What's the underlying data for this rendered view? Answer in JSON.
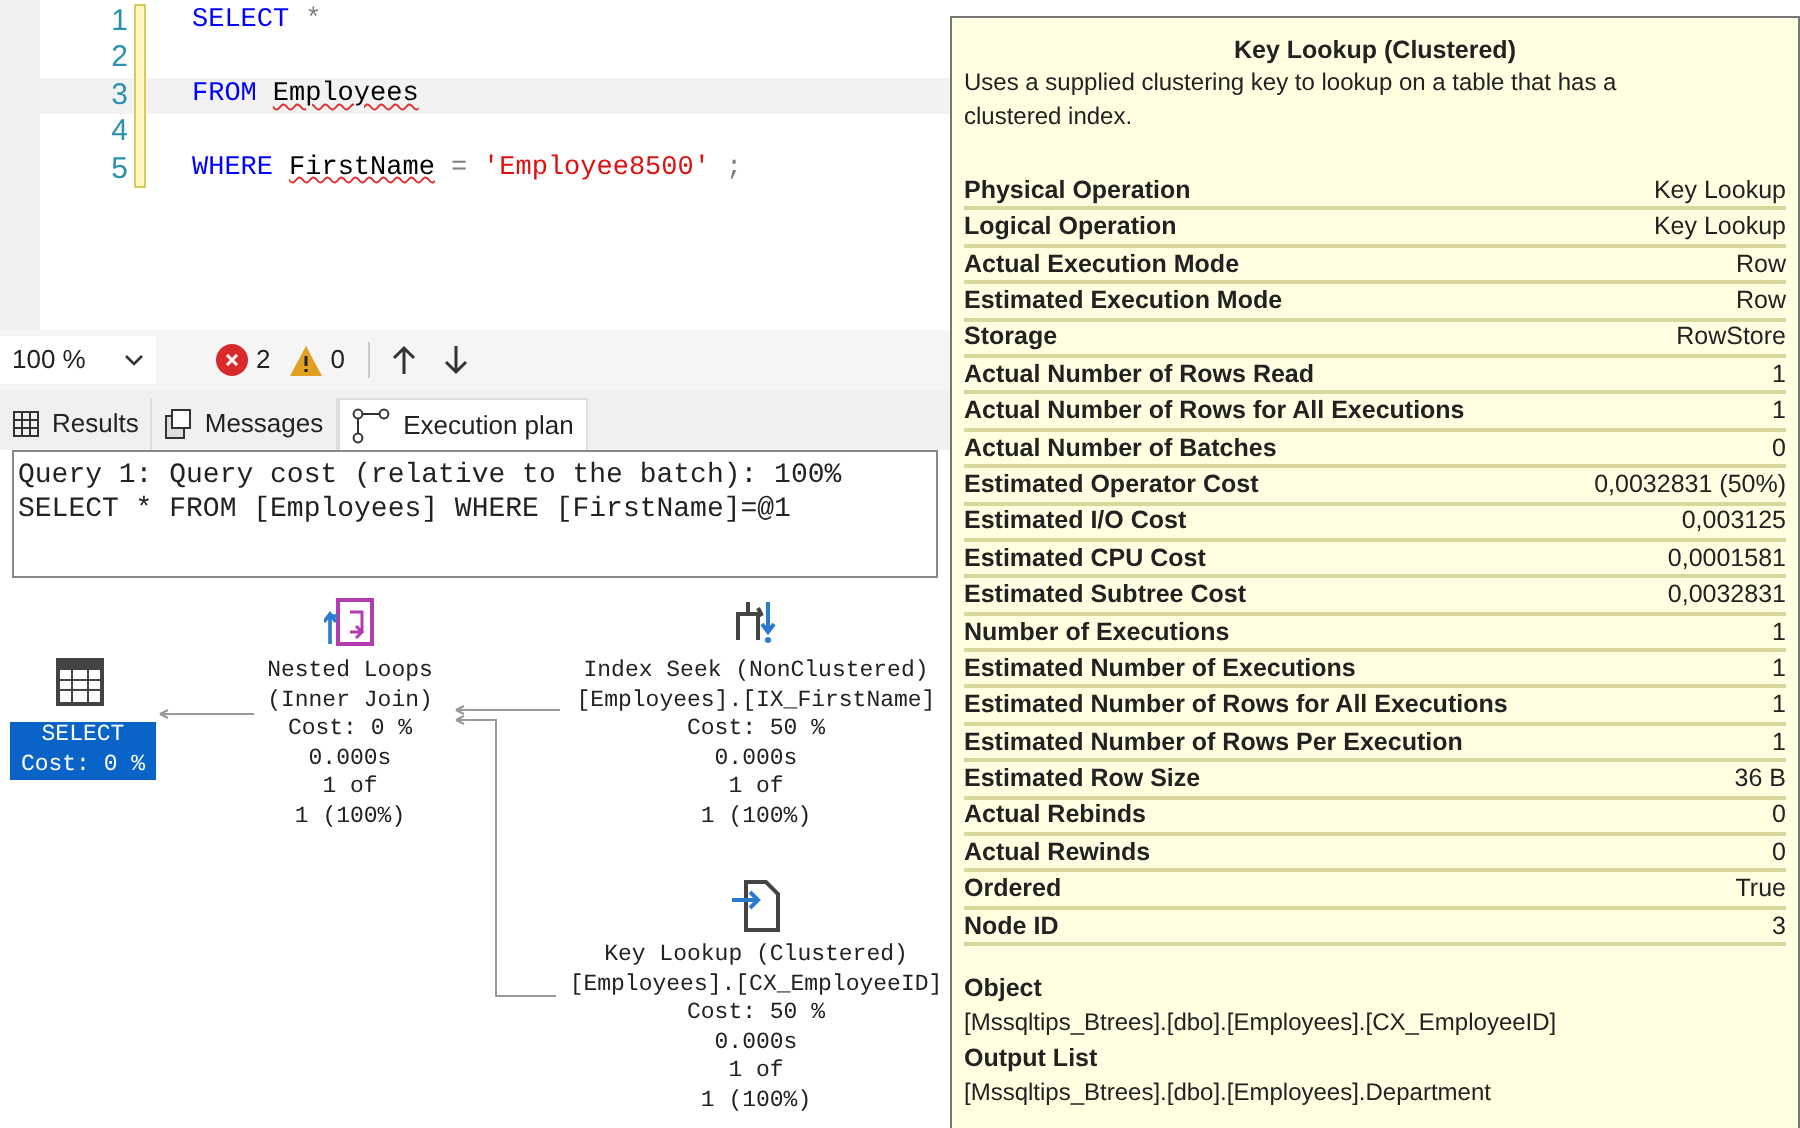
{
  "editor": {
    "lines": [
      {
        "number": "1",
        "current": false,
        "tokens": [
          {
            "text": "SELECT",
            "kind": "keyword",
            "squiggle": false
          },
          {
            "text": "*",
            "kind": "operator",
            "squiggle": false
          }
        ]
      },
      {
        "number": "2",
        "current": false
      },
      {
        "number": "3",
        "current": true,
        "tokens": [
          {
            "text": "FROM",
            "kind": "keyword",
            "squiggle": false
          },
          {
            "text": "Employees",
            "kind": "identifier",
            "squiggle": true
          }
        ]
      },
      {
        "number": "4",
        "current": false
      },
      {
        "number": "5",
        "current": false,
        "tokens": [
          {
            "text": "WHERE",
            "kind": "keyword",
            "squiggle": false
          },
          {
            "text": "FirstName",
            "kind": "identifier",
            "squiggle": true
          },
          {
            "text": "=",
            "kind": "operator",
            "squiggle": false
          },
          {
            "text": "'Employee8500'",
            "kind": "string",
            "squiggle": false
          },
          {
            "text": ";",
            "kind": "operator",
            "squiggle": false
          }
        ]
      }
    ]
  },
  "toolbar": {
    "zoom": "100 %",
    "errors": "2",
    "warnings": "0"
  },
  "tabs": [
    {
      "label": "Results",
      "kind": "grid",
      "selected": false
    },
    {
      "label": "Messages",
      "kind": "messages",
      "selected": false
    },
    {
      "label": "Execution plan",
      "kind": "plan",
      "selected": true
    }
  ],
  "messages": [
    "Query 1: Query cost (relative to the batch): 100%",
    "SELECT * FROM [Employees] WHERE [FirstName]=@1"
  ],
  "plan": {
    "nodes": [
      {
        "kind": "select",
        "selected": true,
        "lines": [
          "SELECT",
          "Cost: 0 %"
        ]
      },
      {
        "kind": "nested_loops",
        "selected": false,
        "lines": [
          "Nested Loops",
          "(Inner Join)",
          "Cost: 0 %",
          "0.000s",
          "1 of",
          "1 (100%)"
        ]
      },
      {
        "kind": "index_seek",
        "selected": false,
        "lines": [
          "Index Seek (NonClustered)",
          "[Employees].[IX_FirstName]",
          "Cost: 50 %",
          "0.000s",
          "1 of",
          "1 (100%)"
        ]
      },
      {
        "kind": "key_lookup",
        "selected": false,
        "lines": [
          "Key Lookup (Clustered)",
          "[Employees].[CX_EmployeeID]",
          "Cost: 50 %",
          "0.000s",
          "1 of",
          "1 (100%)"
        ]
      }
    ]
  },
  "tooltip": {
    "title": "Key Lookup (Clustered)",
    "description": "Uses a supplied clustering key to lookup on a table that has a clustered index.",
    "properties": [
      {
        "name": "Physical Operation",
        "value": "Key Lookup"
      },
      {
        "name": "Logical Operation",
        "value": "Key Lookup"
      },
      {
        "name": "Actual Execution Mode",
        "value": "Row"
      },
      {
        "name": "Estimated Execution Mode",
        "value": "Row"
      },
      {
        "name": "Storage",
        "value": "RowStore"
      },
      {
        "name": "Actual Number of Rows Read",
        "value": "1"
      },
      {
        "name": "Actual Number of Rows for All Executions",
        "value": "1"
      },
      {
        "name": "Actual Number of Batches",
        "value": "0"
      },
      {
        "name": "Estimated Operator Cost",
        "value": "0,0032831 (50%)"
      },
      {
        "name": "Estimated I/O Cost",
        "value": "0,003125"
      },
      {
        "name": "Estimated CPU Cost",
        "value": "0,0001581"
      },
      {
        "name": "Estimated Subtree Cost",
        "value": "0,0032831"
      },
      {
        "name": "Number of Executions",
        "value": "1"
      },
      {
        "name": "Estimated Number of Executions",
        "value": "1"
      },
      {
        "name": "Estimated Number of Rows for All Executions",
        "value": "1"
      },
      {
        "name": "Estimated Number of Rows Per Execution",
        "value": "1"
      },
      {
        "name": "Estimated Row Size",
        "value": "36 B"
      },
      {
        "name": "Actual Rebinds",
        "value": "0"
      },
      {
        "name": "Actual Rewinds",
        "value": "0"
      },
      {
        "name": "Ordered",
        "value": "True"
      },
      {
        "name": "Node ID",
        "value": "3"
      }
    ],
    "sections": [
      {
        "heading": "Object",
        "value": "[Mssqltips_Btrees].[dbo].[Employees].[CX_EmployeeID]"
      },
      {
        "heading": "Output List",
        "value": "[Mssqltips_Btrees].[dbo].[Employees].Department"
      }
    ]
  }
}
